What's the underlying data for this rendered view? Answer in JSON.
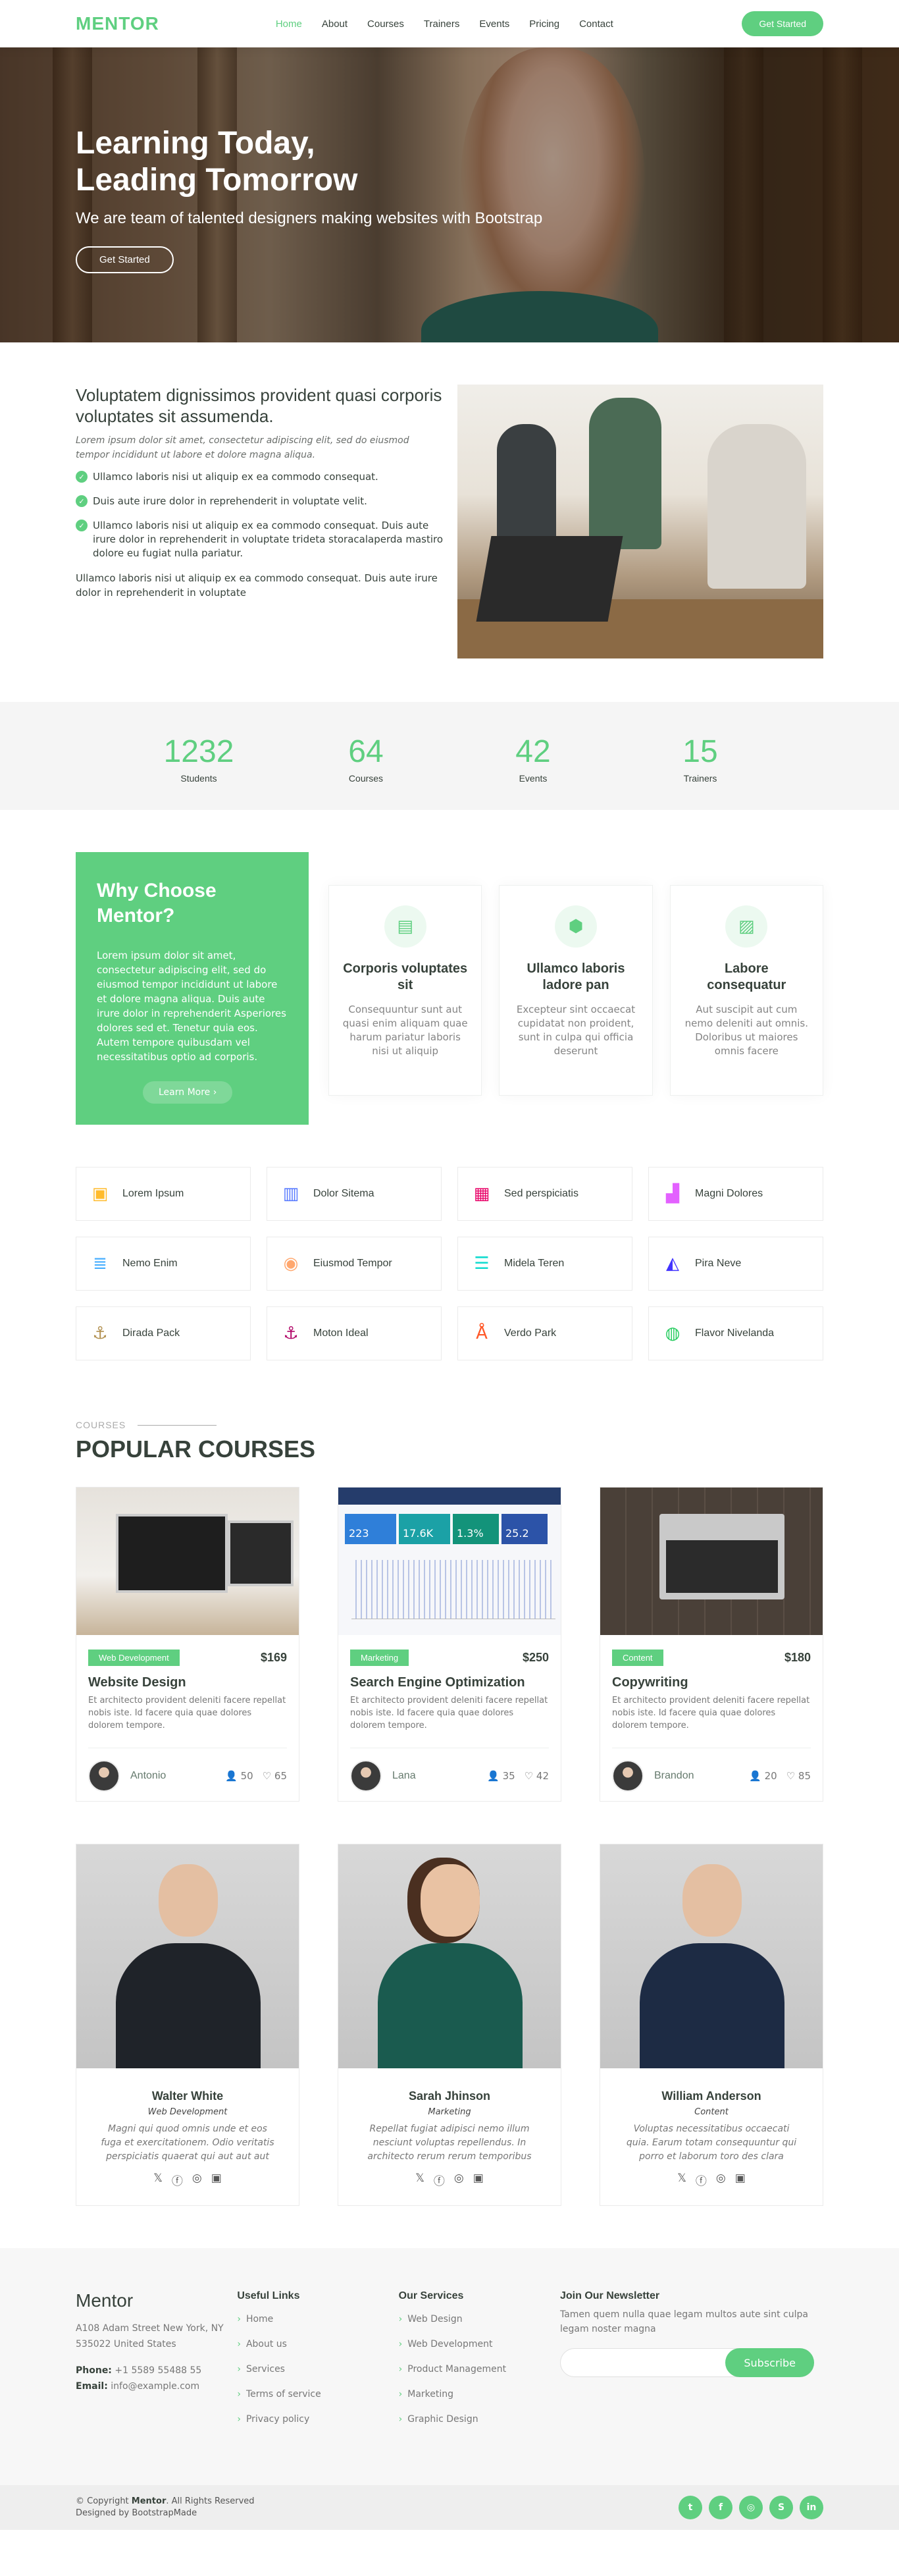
{
  "header": {
    "logo": "MENTOR",
    "nav": [
      "Home",
      "About",
      "Courses",
      "Trainers",
      "Events",
      "Pricing",
      "Contact"
    ],
    "cta": "Get Started"
  },
  "hero": {
    "title_line1": "Learning Today,",
    "title_line2": "Leading Tomorrow",
    "subtitle": "We are team of talented designers making websites with Bootstrap",
    "button": "Get Started"
  },
  "about": {
    "heading": "Voluptatem dignissimos provident quasi corporis voluptates sit assumenda.",
    "lead": "Lorem ipsum dolor sit amet, consectetur adipiscing elit, sed do eiusmod tempor incididunt ut labore et dolore magna aliqua.",
    "bullets": [
      "Ullamco laboris nisi ut aliquip ex ea commodo consequat.",
      "Duis aute irure dolor in reprehenderit in voluptate velit.",
      "Ullamco laboris nisi ut aliquip ex ea commodo consequat. Duis aute irure dolor in reprehenderit in voluptate trideta storacalaperda mastiro dolore eu fugiat nulla pariatur."
    ],
    "tail": "Ullamco laboris nisi ut aliquip ex ea commodo consequat. Duis aute irure dolor in reprehenderit in voluptate"
  },
  "counts": [
    {
      "num": "1232",
      "label": "Students"
    },
    {
      "num": "64",
      "label": "Courses"
    },
    {
      "num": "42",
      "label": "Events"
    },
    {
      "num": "15",
      "label": "Trainers"
    }
  ],
  "why": {
    "title": "Why Choose Mentor?",
    "text": "Lorem ipsum dolor sit amet, consectetur adipiscing elit, sed do eiusmod tempor incididunt ut labore et dolore magna aliqua. Duis aute irure dolor in reprehenderit Asperiores dolores sed et. Tenetur quia eos. Autem tempore quibusdam vel necessitatibus optio ad corporis.",
    "button": "Learn More",
    "boxes": [
      {
        "icon": "document-icon",
        "title": "Corporis voluptates sit",
        "text": "Consequuntur sunt aut quasi enim aliquam quae harum pariatur laboris nisi ut aliquip"
      },
      {
        "icon": "cube-icon",
        "title": "Ullamco laboris ladore pan",
        "text": "Excepteur sint occaecat cupidatat non proident, sunt in culpa qui officia deserunt"
      },
      {
        "icon": "image-icon",
        "title": "Labore consequatur",
        "text": "Aut suscipit aut cum nemo deleniti aut omnis. Doloribus ut maiores omnis facere"
      }
    ]
  },
  "features": [
    {
      "label": "Lorem Ipsum",
      "icon": "store-icon",
      "color": "#ffbb2c"
    },
    {
      "label": "Dolor Sitema",
      "icon": "bar-chart-icon",
      "color": "#5578ff"
    },
    {
      "label": "Sed perspiciatis",
      "icon": "calendar-check-icon",
      "color": "#e80368"
    },
    {
      "label": "Magni Dolores",
      "icon": "paint-roller-icon",
      "color": "#e361ff"
    },
    {
      "label": "Nemo Enim",
      "icon": "database-icon",
      "color": "#47aeff"
    },
    {
      "label": "Eiusmod Tempor",
      "icon": "gradient-icon",
      "color": "#ffa76e"
    },
    {
      "label": "Midela Teren",
      "icon": "file-list-icon",
      "color": "#11dbcf"
    },
    {
      "label": "Pira Neve",
      "icon": "price-tag-icon",
      "color": "#4233ff"
    },
    {
      "label": "Dirada Pack",
      "icon": "anchor-icon",
      "color": "#b2904f"
    },
    {
      "label": "Moton Ideal",
      "icon": "disc-icon",
      "color": "#b20969"
    },
    {
      "label": "Verdo Park",
      "icon": "base-station-icon",
      "color": "#ff5828"
    },
    {
      "label": "Flavor Nivelanda",
      "icon": "fingerprint-icon",
      "color": "#29cc61"
    }
  ],
  "courses": {
    "eyebrow": "Courses",
    "title": "Popular Courses",
    "items": [
      {
        "tag": "Web Development",
        "price": "$169",
        "title": "Website Design",
        "text": "Et architecto provident deleniti facere repellat nobis iste. Id facere quia quae dolores dolorem tempore.",
        "trainer": "Antonio",
        "students": "50",
        "likes": "65"
      },
      {
        "tag": "Marketing",
        "price": "$250",
        "title": "Search Engine Optimization",
        "text": "Et architecto provident deleniti facere repellat nobis iste. Id facere quia quae dolores dolorem tempore.",
        "trainer": "Lana",
        "students": "35",
        "likes": "42"
      },
      {
        "tag": "Content",
        "price": "$180",
        "title": "Copywriting",
        "text": "Et architecto provident deleniti facere repellat nobis iste. Id facere quia quae dolores dolorem tempore.",
        "trainer": "Brandon",
        "students": "20",
        "likes": "85"
      }
    ],
    "seo_stats": [
      "223",
      "17.6K",
      "1.3%",
      "25.2"
    ]
  },
  "trainers": [
    {
      "name": "Walter White",
      "role": "Web Development",
      "text": "Magni qui quod omnis unde et eos fuga et exercitationem. Odio veritatis perspiciatis quaerat qui aut aut aut"
    },
    {
      "name": "Sarah Jhinson",
      "role": "Marketing",
      "text": "Repellat fugiat adipisci nemo illum nesciunt voluptas repellendus. In architecto rerum rerum temporibus"
    },
    {
      "name": "William Anderson",
      "role": "Content",
      "text": "Voluptas necessitatibus occaecati quia. Earum totam consequuntur qui porro et laborum toro des clara"
    }
  ],
  "footer": {
    "brand": "Mentor",
    "address1": "A108 Adam Street New York, NY",
    "address2": "535022 United States",
    "phone_label": "Phone:",
    "phone": "+1 5589 55488 55",
    "email_label": "Email:",
    "email": "info@example.com",
    "useful_title": "Useful Links",
    "useful": [
      "Home",
      "About us",
      "Services",
      "Terms of service",
      "Privacy policy"
    ],
    "services_title": "Our Services",
    "services": [
      "Web Design",
      "Web Development",
      "Product Management",
      "Marketing",
      "Graphic Design"
    ],
    "news_title": "Join Our Newsletter",
    "news_text": "Tamen quem nulla quae legam multos aute sint culpa legam noster magna",
    "subscribe": "Subscribe",
    "copy_prefix": "© Copyright",
    "copy_brand": "Mentor",
    "copy_suffix": ". All Rights Reserved",
    "designed": "Designed by BootstrapMade",
    "social": [
      "twitter-icon",
      "facebook-icon",
      "instagram-icon",
      "skype-icon",
      "linkedin-icon"
    ]
  }
}
